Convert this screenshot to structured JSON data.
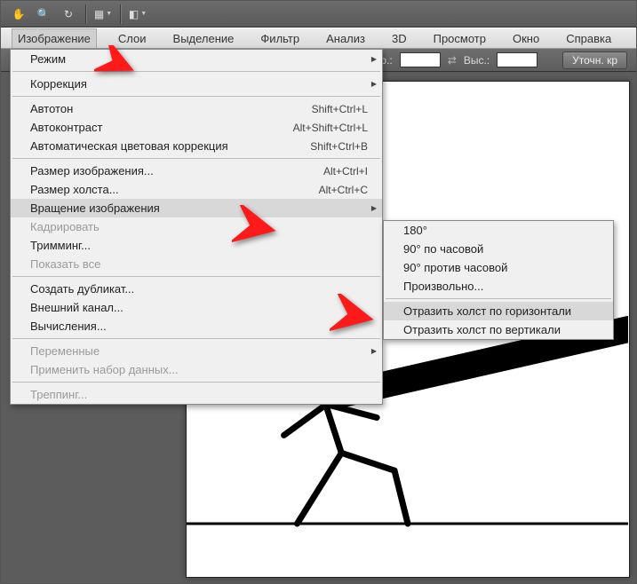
{
  "menubar": {
    "image": "Изображение",
    "layers": "Слои",
    "select": "Выделение",
    "filter": "Фильтр",
    "analysis": "Анализ",
    "threeD": "3D",
    "view": "Просмотр",
    "window": "Окно",
    "help": "Справка"
  },
  "optbar": {
    "width_lbl": "Шир.:",
    "height_lbl": "Выс.:",
    "refine": "Уточн. кр"
  },
  "menu": {
    "mode": "Режим",
    "corrections": "Коррекция",
    "autotone": "Автотон",
    "autotone_k": "Shift+Ctrl+L",
    "autocontrast": "Автоконтраст",
    "autocontrast_k": "Alt+Shift+Ctrl+L",
    "autocolor": "Автоматическая цветовая коррекция",
    "autocolor_k": "Shift+Ctrl+B",
    "imgsize": "Размер изображения...",
    "imgsize_k": "Alt+Ctrl+I",
    "canvassize": "Размер холста...",
    "canvassize_k": "Alt+Ctrl+C",
    "rotate": "Вращение изображения",
    "crop": "Кадрировать",
    "trim": "Тримминг...",
    "revealall": "Показать все",
    "duplicate": "Создать дубликат...",
    "apply": "Внешний канал...",
    "calc": "Вычисления...",
    "vars": "Переменные",
    "dataset": "Применить набор данных...",
    "trap": "Треппинг..."
  },
  "submenu": {
    "d180": "180°",
    "cw90": "90° по часовой",
    "ccw90": "90° против часовой",
    "arb": "Произвольно...",
    "fliph": "Отразить холст по горизонтали",
    "flipv": "Отразить холст по вертикали"
  }
}
